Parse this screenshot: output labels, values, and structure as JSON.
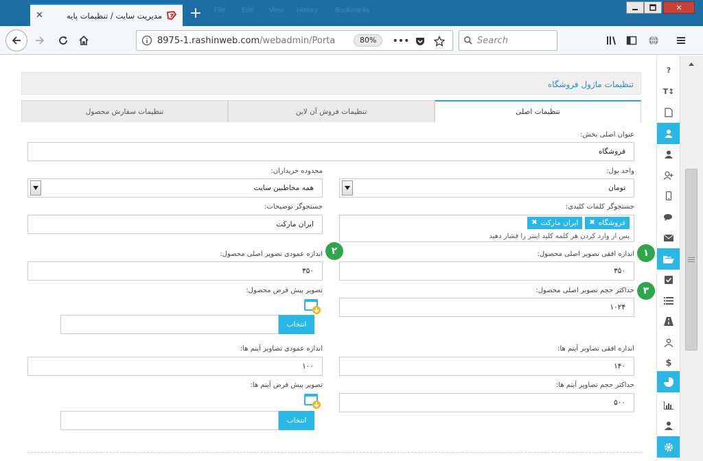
{
  "browser": {
    "tab_title": "مدیریت سایت / تنظیمات پایه",
    "url_host": "8975-1.rashinweb.com",
    "url_path": "/webadmin/Porta",
    "zoom": "80%",
    "search_placeholder": "Search"
  },
  "page": {
    "header_title": "تنظیمات ماژول فروشگاه",
    "tabs": [
      {
        "label": "تنظیمات اصلی",
        "active": true
      },
      {
        "label": "تنظیمات فروش آن لاین",
        "active": false
      },
      {
        "label": "تنظیمات سفارش محصول",
        "active": false
      }
    ],
    "section_title": {
      "label": "عنوان اصلی بخش:",
      "value": "فروشگاه"
    },
    "currency": {
      "label": "واحد پول:",
      "value": "تومان"
    },
    "buyers_scope": {
      "label": "محدوده خریداران:",
      "value": "همه مخاطبین سایت"
    },
    "keywords": {
      "label": "جستجوگر کلمات کلیدی:",
      "tags": [
        "فروشگاه",
        "ایران مارکت"
      ],
      "hint": "پس از وارد کردن هر کلمه کلید اینتر را فشار دهید"
    },
    "description_search": {
      "label": "جستجوگر توضیحات:",
      "value": "ایران مارکت"
    },
    "main_img_width": {
      "label": "اندازه افقی تصویر اصلی محصول:",
      "value": "۳۵۰"
    },
    "main_img_height": {
      "label": "اندازه عمودی تصویر اصلی محصول:",
      "value": "۳۵۰"
    },
    "main_img_max_size": {
      "label": "حداکثر حجم تصویر اصلی محصول:",
      "value": "۱۰۲۴"
    },
    "default_product_img": {
      "label": "تصویر پیش فرض محصول:",
      "button": "انتخاب"
    },
    "item_img_width": {
      "label": "اندازه افقی تصاویر آیتم ها:",
      "value": "۱۴۰"
    },
    "item_img_height": {
      "label": "اندازه عمودی تصاویر آیتم ها:",
      "value": "۱۰۰"
    },
    "item_img_max_size": {
      "label": "حداکثر حجم تصاویر آیتم ها:",
      "value": "۵۰۰"
    },
    "default_item_img": {
      "label": "تصویر پیش فرض آیتم ها:",
      "button": "انتخاب"
    },
    "badges": [
      "۱",
      "۲",
      "۳"
    ]
  },
  "sidebar_icons": [
    {
      "icon": "help-icon",
      "glyph": "?"
    },
    {
      "icon": "text-size-icon",
      "glyph": "T↕"
    },
    {
      "icon": "file-icon",
      "glyph": ""
    },
    {
      "icon": "users-icon",
      "glyph": ""
    },
    {
      "icon": "user-icon",
      "glyph": ""
    },
    {
      "icon": "user-add-icon",
      "glyph": ""
    },
    {
      "icon": "mobile-icon",
      "glyph": ""
    },
    {
      "icon": "comments-icon",
      "glyph": ""
    },
    {
      "icon": "envelope-icon",
      "glyph": ""
    },
    {
      "icon": "folder-open-icon",
      "glyph": ""
    },
    {
      "icon": "checkbox-icon",
      "glyph": ""
    },
    {
      "icon": "list-icon",
      "glyph": ""
    },
    {
      "icon": "road-icon",
      "glyph": ""
    },
    {
      "icon": "group-icon",
      "glyph": ""
    },
    {
      "icon": "dollar-icon",
      "glyph": "$"
    },
    {
      "icon": "pie-chart-icon",
      "glyph": ""
    },
    {
      "icon": "bar-chart-icon",
      "glyph": ""
    },
    {
      "icon": "user-tie-icon",
      "glyph": ""
    },
    {
      "icon": "gear-icon",
      "glyph": ""
    }
  ],
  "colors": {
    "accent": "#29b8e5",
    "badge": "#30a64a",
    "header_text": "#2a8bbf",
    "titlebar": "#1c6ea4"
  }
}
